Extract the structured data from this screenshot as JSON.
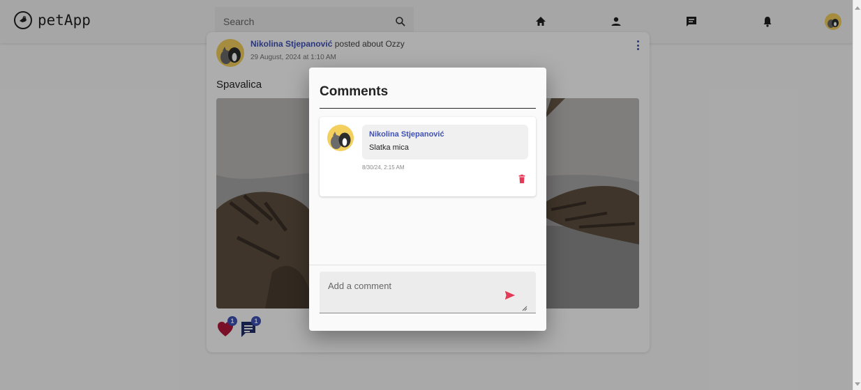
{
  "app": {
    "name": "petApp",
    "accent_color": "#3f51b5",
    "danger_color": "#e53958",
    "logo_icon": "pet-hand-icon"
  },
  "header": {
    "search": {
      "placeholder": "Search",
      "value": ""
    },
    "nav_icons": [
      "home-icon",
      "person-icon",
      "chat-icon",
      "bell-icon",
      "avatar"
    ]
  },
  "post": {
    "author": "Nikolina Stjepanović",
    "action": "posted about Ozzy",
    "date": "29 August, 2024 at 1:10 AM",
    "text": "Spavalica",
    "likes_count": "1",
    "comments_count": "1"
  },
  "dialog": {
    "title": "Comments",
    "comments": [
      {
        "author": "Nikolina Stjepanović",
        "text": "Slatka mica",
        "time": "8/30/24, 2:15 AM"
      }
    ],
    "input": {
      "placeholder": "Add a comment",
      "value": ""
    }
  }
}
